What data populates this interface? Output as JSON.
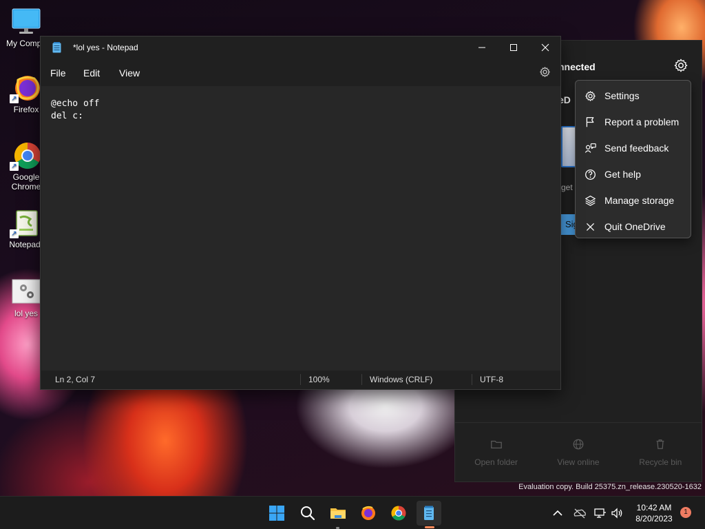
{
  "desktop": {
    "icons": [
      {
        "label": "My Compu",
        "icon": "monitor-icon"
      },
      {
        "label": "Firefox",
        "icon": "firefox-icon"
      },
      {
        "label": "Google Chrome",
        "icon": "chrome-icon"
      },
      {
        "label": "Notepad-",
        "icon": "notepadpp-icon"
      },
      {
        "label": "lol yes",
        "icon": "batch-file-icon"
      }
    ]
  },
  "notepad": {
    "title": "*lol yes - Notepad",
    "menu": {
      "file": "File",
      "edit": "Edit",
      "view": "View"
    },
    "content": "@echo off\ndel c:",
    "status": {
      "position": "Ln 2, Col 7",
      "zoom": "100%",
      "line_ending": "Windows (CRLF)",
      "encoding": "UTF-8"
    }
  },
  "onedrive": {
    "status_partial": "nnected",
    "name_partial": "eD",
    "get_partial": "get",
    "signin_partial": "Sig",
    "footer": {
      "open_folder": "Open folder",
      "view_online": "View online",
      "recycle_bin": "Recycle bin"
    },
    "menu": [
      {
        "label": "Settings",
        "icon": "gear-icon"
      },
      {
        "label": "Report a problem",
        "icon": "flag-icon"
      },
      {
        "label": "Send feedback",
        "icon": "feedback-icon"
      },
      {
        "label": "Get help",
        "icon": "help-icon"
      },
      {
        "label": "Manage storage",
        "icon": "layers-icon"
      },
      {
        "label": "Quit OneDrive",
        "icon": "close-icon"
      }
    ]
  },
  "watermark": "Evaluation copy. Build 25375.zn_release.230520-1632",
  "taskbar": {
    "time": "10:42 AM",
    "date": "8/20/2023",
    "notification_count": "1"
  },
  "colors": {
    "accent": "#4aa0e6",
    "notepad_indicator": "#ff8a5b",
    "badge": "#f07c62"
  }
}
